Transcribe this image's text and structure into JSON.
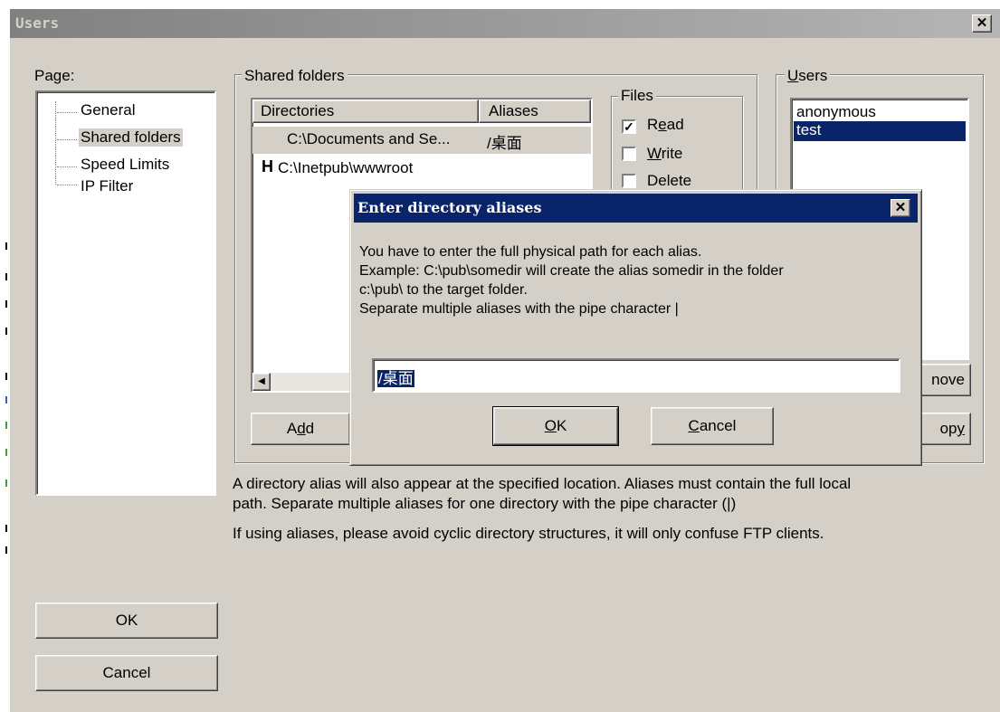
{
  "window": {
    "title": "Users",
    "close_glyph": "✕"
  },
  "page_panel": {
    "label": "Page:",
    "items": [
      "General",
      "Shared folders",
      "Speed Limits",
      "IP Filter"
    ],
    "selected_index": 1
  },
  "shared_folders": {
    "group_label": "Shared folders",
    "columns": [
      "Directories",
      "Aliases"
    ],
    "rows": [
      {
        "marker": "",
        "directory": "C:\\Documents and Se...",
        "alias": "/桌面"
      },
      {
        "marker": "H",
        "directory": "C:\\Inetpub\\wwwroot",
        "alias": ""
      }
    ],
    "add_button": {
      "pre": "A",
      "hot": "d",
      "post": "d"
    },
    "files_group": {
      "label": "Files",
      "options": [
        {
          "pre": "R",
          "hot": "e",
          "post": "ad",
          "checked": true
        },
        {
          "pre": "",
          "hot": "W",
          "post": "rite",
          "checked": false
        },
        {
          "pre": "",
          "hot": "",
          "post": "Delete",
          "checked": false
        }
      ]
    }
  },
  "users_panel": {
    "label_hot": "U",
    "label_rest": "sers",
    "items": [
      "anonymous",
      "test"
    ],
    "selected_index": 1,
    "remove_partial": "nove",
    "copy_partial_pre": "op",
    "copy_partial_hot": "y"
  },
  "info": {
    "line1": "A directory alias will also appear at the specified location. Aliases must contain the full local",
    "line2": "path. Separate multiple aliases for one directory with the pipe character (|)",
    "line3": "If using aliases, please avoid cyclic directory structures, it will only confuse FTP clients."
  },
  "main_buttons": {
    "ok": "OK",
    "cancel": "Cancel"
  },
  "dialog": {
    "title": "Enter directory aliases",
    "close_glyph": "✕",
    "message_lines": [
      "You have to enter the full physical path for each alias.",
      "Example: C:\\pub\\somedir will create the alias somedir in the folder",
      "c:\\pub\\ to the target folder.",
      "Separate multiple aliases with the pipe character |"
    ],
    "input_value": "/桌面",
    "ok_hot": "O",
    "ok_rest": "K",
    "cancel_hot": "C",
    "cancel_rest": "ancel"
  },
  "colors": {
    "inactive_title": "#808080",
    "active_title": "#0a246a",
    "selection": "#0a246a",
    "face": "#d4d0c8"
  }
}
